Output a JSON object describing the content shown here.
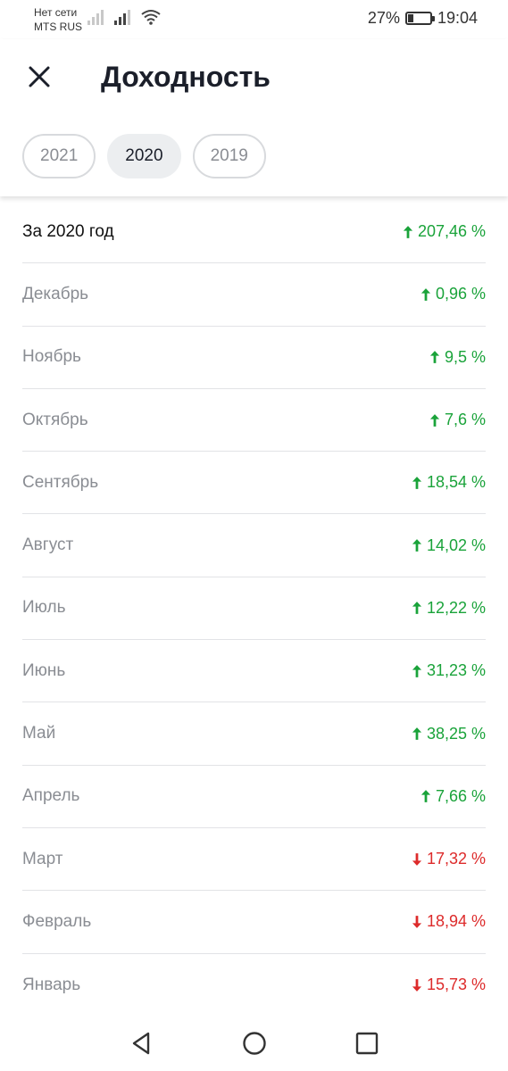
{
  "status_bar": {
    "carrier_line1": "Нет сети",
    "carrier_line2": "MTS RUS",
    "battery_percent": "27%",
    "battery_level": 0.27,
    "time": "19:04"
  },
  "header": {
    "title": "Доходность",
    "close_icon": "close-icon"
  },
  "tabs": [
    {
      "label": "2021",
      "active": false
    },
    {
      "label": "2020",
      "active": true
    },
    {
      "label": "2019",
      "active": false
    }
  ],
  "rows": [
    {
      "label": "За 2020 год",
      "value": "207,46 %",
      "direction": "up",
      "total": true
    },
    {
      "label": "Декабрь",
      "value": "0,96 %",
      "direction": "up"
    },
    {
      "label": "Ноябрь",
      "value": "9,5 %",
      "direction": "up"
    },
    {
      "label": "Октябрь",
      "value": "7,6 %",
      "direction": "up"
    },
    {
      "label": "Сентябрь",
      "value": "18,54 %",
      "direction": "up"
    },
    {
      "label": "Август",
      "value": "14,02 %",
      "direction": "up"
    },
    {
      "label": "Июль",
      "value": "12,22 %",
      "direction": "up"
    },
    {
      "label": "Июнь",
      "value": "31,23 %",
      "direction": "up"
    },
    {
      "label": "Май",
      "value": "38,25 %",
      "direction": "up"
    },
    {
      "label": "Апрель",
      "value": "7,66 %",
      "direction": "up"
    },
    {
      "label": "Март",
      "value": "17,32 %",
      "direction": "down"
    },
    {
      "label": "Февраль",
      "value": "18,94 %",
      "direction": "down"
    },
    {
      "label": "Январь",
      "value": "15,73 %",
      "direction": "down"
    }
  ],
  "colors": {
    "up": "#1aa33a",
    "down": "#dd2b2b",
    "title": "#1b1f2a",
    "muted": "#8a8d93"
  }
}
